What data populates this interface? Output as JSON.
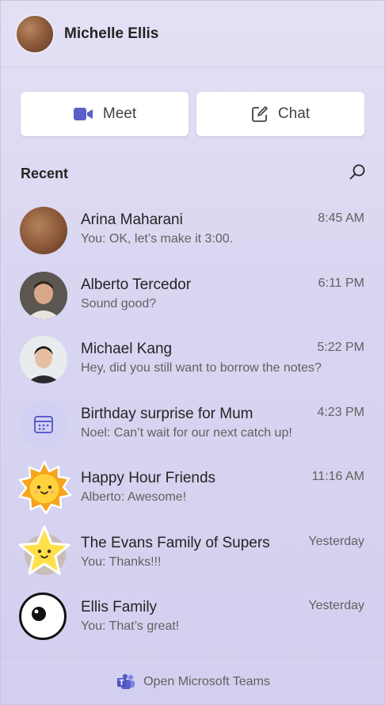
{
  "header": {
    "name": "Michelle Ellis",
    "avatar_icon": "profile-photo"
  },
  "actions": {
    "meet_label": "Meet",
    "chat_label": "Chat"
  },
  "recent": {
    "label": "Recent",
    "search_icon": "search-icon"
  },
  "conversations": [
    {
      "title": "Arina Maharani",
      "preview": "You: OK, let’s make it 3:00.",
      "time": "8:45 AM",
      "avatar": "photo"
    },
    {
      "title": "Alberto Tercedor",
      "preview": "Sound good?",
      "time": "6:11 PM",
      "avatar": "photo"
    },
    {
      "title": "Michael Kang",
      "preview": "Hey, did you still want to borrow the notes?",
      "time": "5:22 PM",
      "avatar": "photo"
    },
    {
      "title": "Birthday surprise for Mum",
      "preview": "Noel: Can’t wait for our next catch up!",
      "time": "4:23 PM",
      "avatar": "calendar-icon"
    },
    {
      "title": "Happy Hour Friends",
      "preview": "Alberto: Awesome!",
      "time": "11:16 AM",
      "avatar": "sun-icon"
    },
    {
      "title": "The Evans Family of Supers",
      "preview": "You: Thanks!!!",
      "time": "Yesterday",
      "avatar": "star-icon"
    },
    {
      "title": "Ellis Family",
      "preview": "You: That’s great!",
      "time": "Yesterday",
      "avatar": "eye-icon"
    }
  ],
  "footer": {
    "label": "Open Microsoft Teams",
    "icon": "teams-icon"
  },
  "colors": {
    "accent": "#5b5fc7",
    "background": "#dcd8f2"
  }
}
